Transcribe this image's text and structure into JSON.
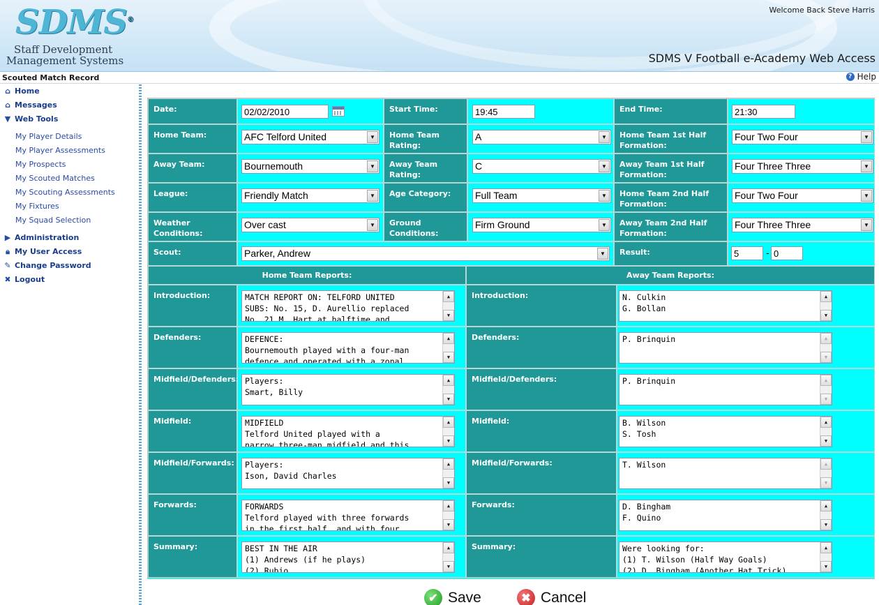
{
  "header": {
    "logo_mark": "SDMS",
    "logo_reg": "®",
    "logo_line1": "Staff Development",
    "logo_line2": "Management Systems",
    "welcome": "Welcome Back Steve Harris",
    "app_title": "SDMS V Football e-Academy Web Access"
  },
  "titlebar": {
    "page_title": "Scouted Match Record",
    "help": "Help"
  },
  "sidebar": {
    "home": "Home",
    "messages": "Messages",
    "web_tools": "Web Tools",
    "sub": [
      "My Player Details",
      "My Player Assessments",
      "My Prospects",
      "My Scouted Matches",
      "My Scouting Assessments",
      "My Fixtures",
      "My Squad Selection"
    ],
    "administration": "Administration",
    "user_access": "My User Access",
    "change_password": "Change Password",
    "logout": "Logout"
  },
  "form": {
    "date_label": "Date:",
    "date": "02/02/2010",
    "start_label": "Start Time:",
    "start": "19:45",
    "end_label": "End Time:",
    "end": "21:30",
    "home_team_label": "Home Team:",
    "home_team": "AFC Telford United",
    "home_rating_label_1": "Home Team",
    "home_rating_label_2": "Rating:",
    "home_rating": "A",
    "home_1h_label_1": "Home Team 1st Half",
    "home_1h_label_2": "Formation:",
    "home_1h": "Four Two Four",
    "away_team_label": "Away Team:",
    "away_team": "Bournemouth",
    "away_rating_label": "Away Team Rating:",
    "away_rating": "C",
    "away_1h_label_1": "Away Team 1st Half",
    "away_1h_label_2": "Formation:",
    "away_1h": "Four Three Three",
    "league_label": "League:",
    "league": "Friendly Match",
    "age_label": "Age Category:",
    "age": "Full Team",
    "home_2h_label_1": "Home Team 2nd Half",
    "home_2h_label_2": "Formation:",
    "home_2h": "Four Two Four",
    "weather_label": "Weather Conditions:",
    "weather": "Over cast",
    "ground_label": "Ground Conditions:",
    "ground": "Firm Ground",
    "away_2h_label_1": "Away Team 2nd Half",
    "away_2h_label_2": "Formation:",
    "away_2h": "Four Three Three",
    "scout_label": "Scout:",
    "scout": "Parker, Andrew",
    "result_label": "Result:",
    "result_home": "5",
    "result_sep": "-",
    "result_away": "0",
    "home_reports": "Home Team Reports:",
    "away_reports": "Away Team Reports:"
  },
  "reports": [
    {
      "label": "Introduction:",
      "home": "MATCH REPORT ON: TELFORD UNITED\nSUBS: No. 15, D. Aurellio replaced\nNo. 21 M. Hart at halftime and",
      "away": "N. Culkin\nG. Bollan"
    },
    {
      "label": "Defenders:",
      "home": "DEFENCE:\nBournemouth played with a four-man\ndefence and operated with a zonal",
      "away": "P. Brinquin"
    },
    {
      "label": "Midfield/Defenders:",
      "home": "Players:\nSmart, Billy",
      "away": "P. Brinquin"
    },
    {
      "label": "Midfield:",
      "home": "MIDFIELD\nTelford United played with a\nnarrow three-man midfield and this",
      "away": "B. Wilson\nS. Tosh"
    },
    {
      "label": "Midfield/Forwards:",
      "home": "Players:\nIson, David Charles",
      "away": "T. Wilson"
    },
    {
      "label": "Forwards:",
      "home": "FORWARDS\nTelford played with three forwards\nin the first half, and with four",
      "away": "D. Bingham\nF. Quino"
    },
    {
      "label": "Summary:",
      "home": "BEST IN THE AIR\n(1) Andrews (if he plays)\n(2) Rubio",
      "away": "Were looking for:\n(1) T. Wilson (Half Way Goals)\n(2) D. Bingham (Another Hat Trick)"
    }
  ],
  "footer": {
    "save": "Save",
    "cancel": "Cancel"
  },
  "colors": {
    "label_bg": "#209898",
    "field_bg": "#00ffff",
    "nav_text": "#1a3d8a"
  }
}
